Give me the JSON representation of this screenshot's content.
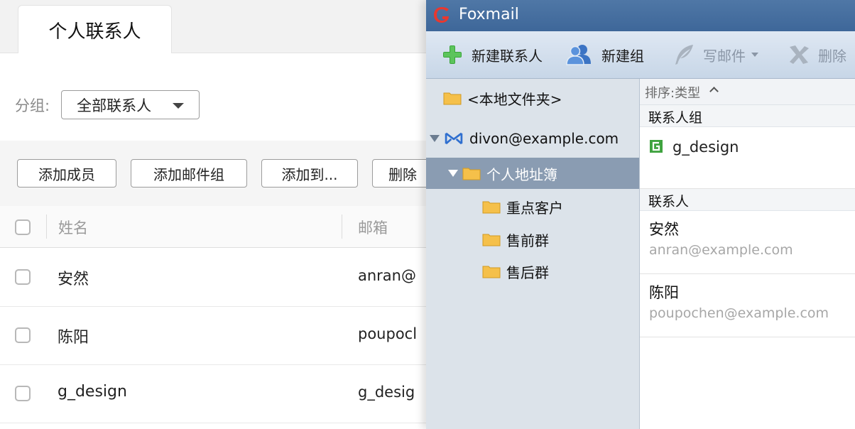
{
  "web": {
    "tab_title": "个人联系人",
    "group_label": "分组:",
    "group_select_value": "全部联系人",
    "actions": [
      "添加成员",
      "添加邮件组",
      "添加到...",
      "删除"
    ],
    "table": {
      "headers": [
        "姓名",
        "邮箱"
      ],
      "rows": [
        {
          "name": "安然",
          "email": "anran@"
        },
        {
          "name": "陈阳",
          "email": "poupocl"
        },
        {
          "name": "g_design",
          "email": "g_desig"
        }
      ]
    }
  },
  "foxmail": {
    "title": "Foxmail",
    "toolbar": {
      "new_contact": "新建联系人",
      "new_group": "新建组",
      "write_mail": "写邮件",
      "delete": "删除"
    },
    "tree": {
      "local_folder": "<本地文件夹>",
      "account": "divon@example.com",
      "address_book": "个人地址簿",
      "subfolders": [
        "重点客户",
        "售前群",
        "售后群"
      ]
    },
    "list": {
      "sort_label": "排序:类型",
      "groups_header": "联系人组",
      "group_name": "g_design",
      "contacts_header": "联系人",
      "contacts": [
        {
          "name": "安然",
          "email": "anran@example.com"
        },
        {
          "name": "陈阳",
          "email": "poupochen@example.com"
        }
      ]
    }
  },
  "colors": {
    "title_bar": "#3e6799",
    "selected_row": "#8a9cb2",
    "tree_background": "#dce3ea",
    "folder_yellow": "#f5c04a"
  }
}
